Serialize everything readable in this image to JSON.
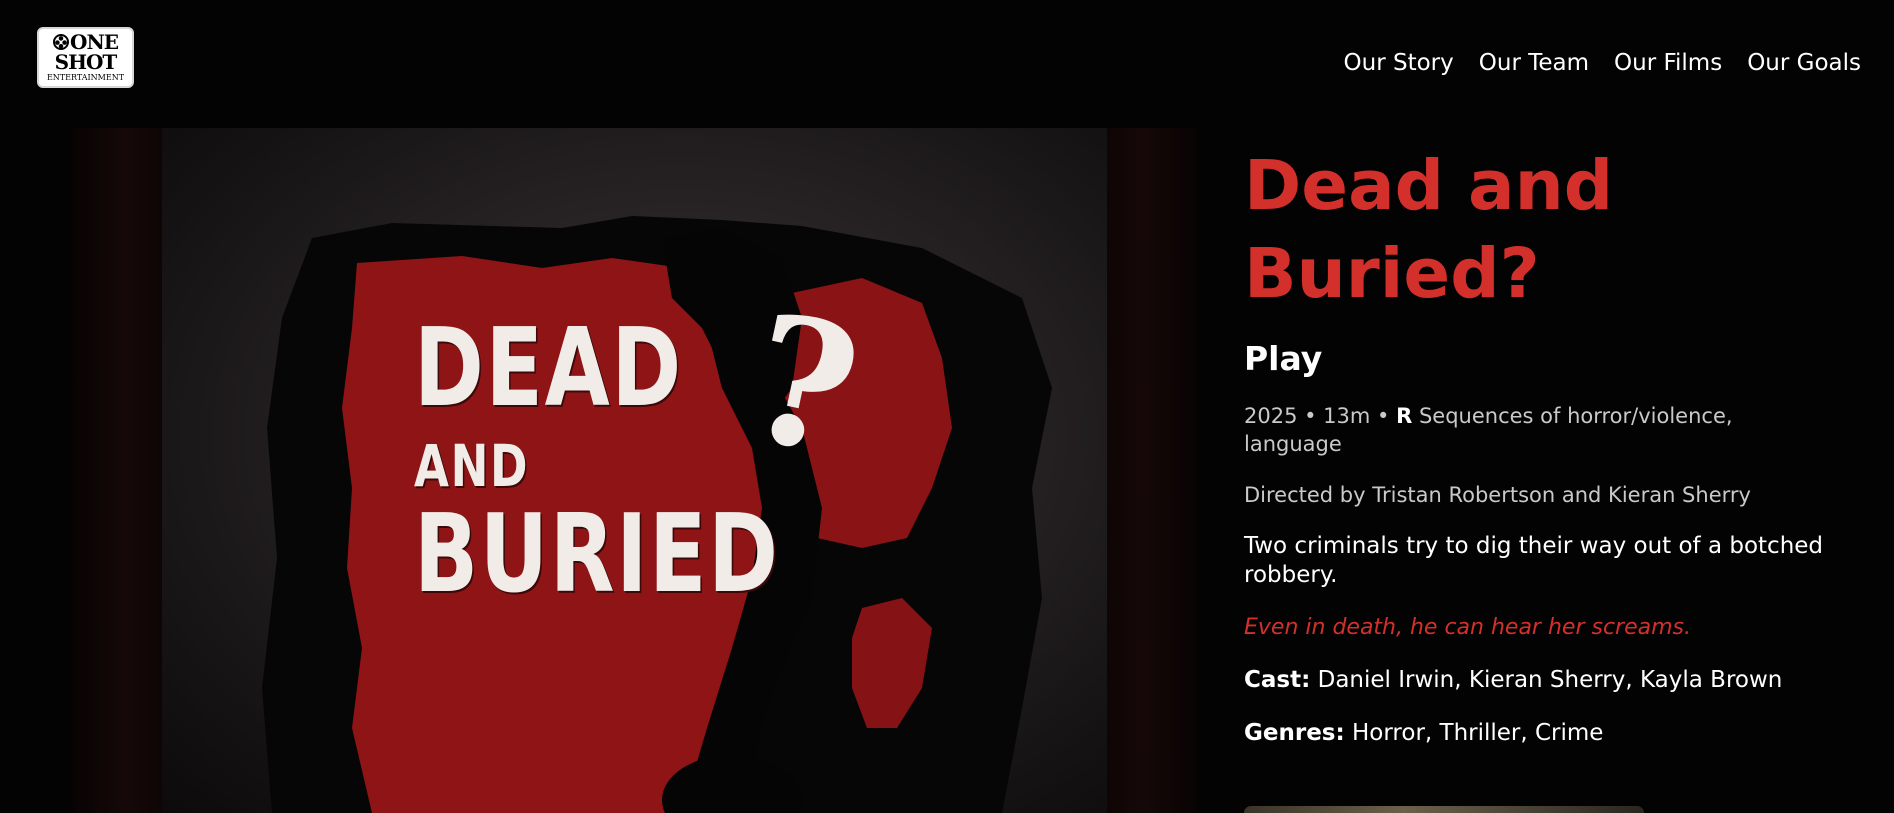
{
  "header": {
    "logo": {
      "line1": "ONE",
      "line2": "SHOT",
      "line3": "ENTERTAINMENT"
    },
    "nav": [
      "Our Story",
      "Our Team",
      "Our Films",
      "Our Goals"
    ]
  },
  "poster": {
    "title_line1": "DEAD",
    "title_line2": "AND",
    "title_line3": "BURIED",
    "title_mark": "?",
    "colors": {
      "paint": "#8e1416",
      "background": "#2a2627"
    }
  },
  "film": {
    "title": "Dead and Buried?",
    "play_label": "Play",
    "meta_prefix": "2025 • 13m • ",
    "rating": "R",
    "rating_reason": " Sequences of horror/violence, language",
    "director": "Directed by Tristan Robertson and Kieran Sherry",
    "synopsis": "Two criminals try to dig their way out of a botched robbery.",
    "tagline": "Even in death, he can hear her screams.",
    "cast_label": "Cast:",
    "cast": " Daniel Irwin, Kieran Sherry, Kayla Brown",
    "genres_label": "Genres:",
    "genres": " Horror, Thriller, Crime"
  },
  "colors": {
    "accent": "#d3302b",
    "background": "#030303",
    "muted_text": "#c9c9c9"
  }
}
